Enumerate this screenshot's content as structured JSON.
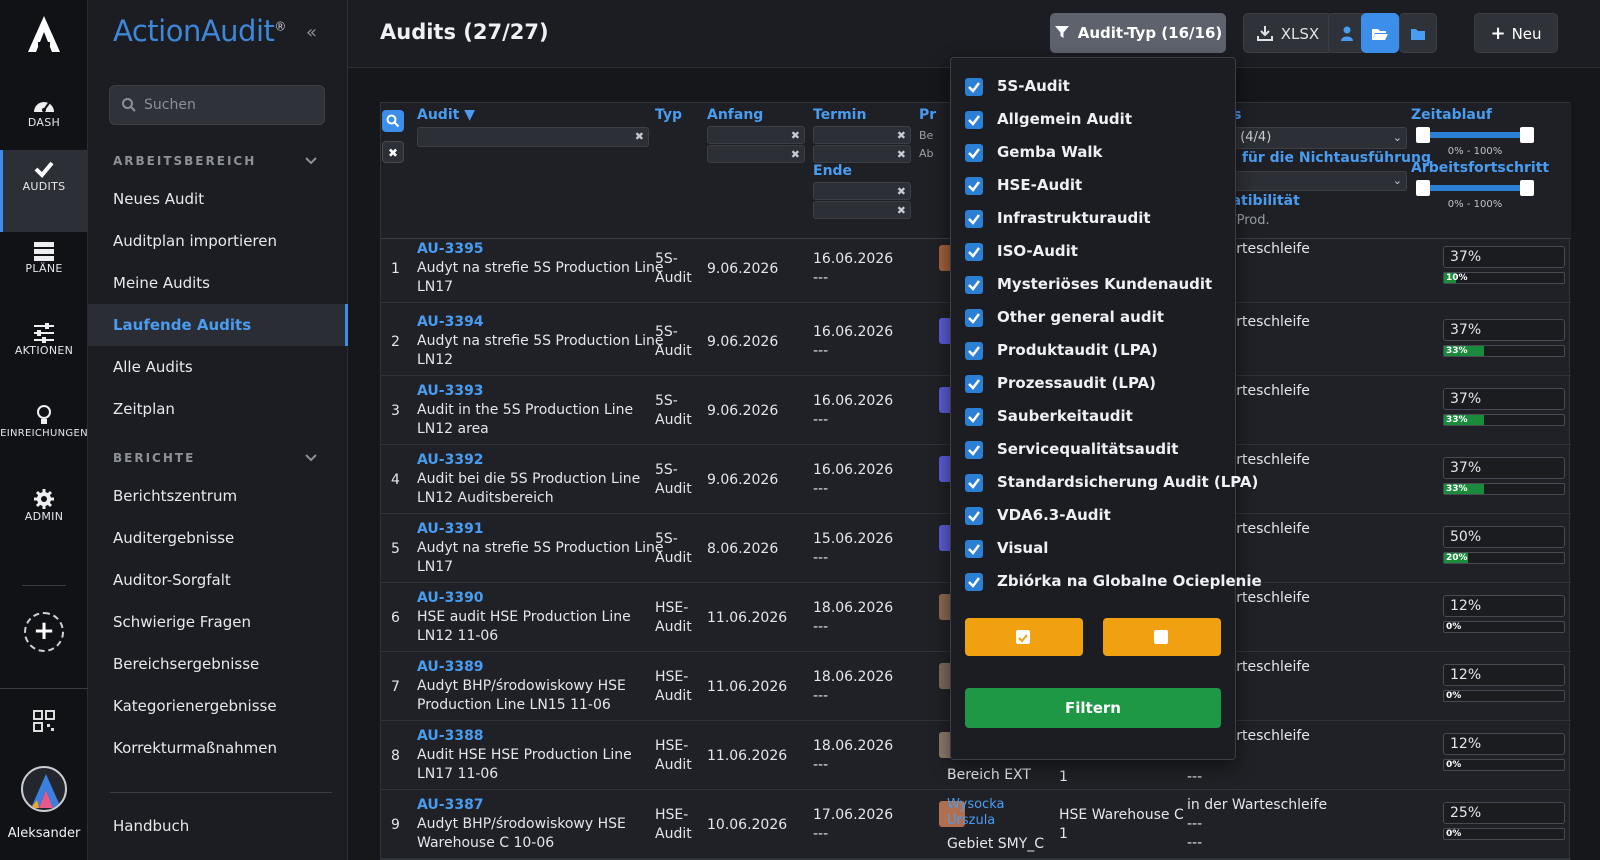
{
  "rail": {
    "items": [
      {
        "label": "DASH"
      },
      {
        "label": "AUDITS"
      },
      {
        "label": "PLÄNE"
      },
      {
        "label": "AKTIONEN"
      },
      {
        "label": "EINREICHUNGEN"
      },
      {
        "label": "ADMIN"
      }
    ],
    "user": "Aleksander"
  },
  "sidebar": {
    "brand": "ActionAudit",
    "brand_mark": "®",
    "search_placeholder": "Suchen",
    "section1": "ARBEITSBEREICH",
    "items1": [
      "Neues Audit",
      "Auditplan importieren",
      "Meine Audits",
      "Laufende Audits",
      "Alle Audits",
      "Zeitplan"
    ],
    "section2": "BERICHTE",
    "items2": [
      "Berichtszentrum",
      "Auditergebnisse",
      "Auditor-Sorgfalt",
      "Schwierige Fragen",
      "Bereichsergebnisse",
      "Kategorienergebnisse",
      "Korrekturmaßnahmen"
    ],
    "handbook": "Handbuch"
  },
  "header": {
    "title": "Audits (27/27)",
    "type_filter": "Audit-Typ (16/16)",
    "xlsx": "XLSX",
    "new": "Neu"
  },
  "table": {
    "headers": {
      "audit": "Audit ▼",
      "typ": "Typ",
      "anfang": "Anfang",
      "termin": "Termin",
      "ende": "Ende",
      "pr": "Pr",
      "pr_sub1": "Be",
      "pr_sub2": "Ab",
      "status": "atus",
      "status_select": "atus (4/4)",
      "grund": "und für die Nichtausführung",
      "kompat": "mpatibilität",
      "kompat_sub": "udit/Prod.",
      "zeitablauf": "Zeitablauf",
      "zeit_range": "0% - 100%",
      "arbeit": "Arbeitsfortschritt",
      "arbeit_range": "0% - 100%"
    },
    "rows": [
      {
        "n": "1",
        "id": "AU-3395",
        "name": [
          "Audyt na strefie 5S Production Line",
          "LN17"
        ],
        "typ": [
          "5S-",
          "Audit"
        ],
        "anfang": "9.06.2026",
        "termin": "16.06.2026",
        "ende": "---",
        "status": "der Warteschleife",
        "time": "37%",
        "time_v": 37,
        "work": "10%",
        "work_v": 10
      },
      {
        "n": "2",
        "id": "AU-3394",
        "name": [
          "Audyt na strefie 5S Production Line",
          "LN12"
        ],
        "typ": [
          "5S-",
          "Audit"
        ],
        "anfang": "9.06.2026",
        "termin": "16.06.2026",
        "ende": "---",
        "status": "der Warteschleife",
        "time": "37%",
        "time_v": 37,
        "work": "33%",
        "work_v": 33
      },
      {
        "n": "3",
        "id": "AU-3393",
        "name": [
          "Audit in the 5S Production Line",
          "LN12 area"
        ],
        "typ": [
          "5S-",
          "Audit"
        ],
        "anfang": "9.06.2026",
        "termin": "16.06.2026",
        "ende": "---",
        "status": "der Warteschleife",
        "time": "37%",
        "time_v": 37,
        "work": "33%",
        "work_v": 33
      },
      {
        "n": "4",
        "id": "AU-3392",
        "name": [
          "Audit bei die 5S Production Line",
          "LN12 Auditsbereich"
        ],
        "typ": [
          "5S-",
          "Audit"
        ],
        "anfang": "9.06.2026",
        "termin": "16.06.2026",
        "ende": "---",
        "status": "der Warteschleife",
        "time": "37%",
        "time_v": 37,
        "work": "33%",
        "work_v": 33
      },
      {
        "n": "5",
        "id": "AU-3391",
        "name": [
          "Audyt na strefie 5S Production Line",
          "LN17"
        ],
        "typ": [
          "5S-",
          "Audit"
        ],
        "anfang": "8.06.2026",
        "termin": "15.06.2026",
        "ende": "---",
        "status": "der Warteschleife",
        "time": "50%",
        "time_v": 50,
        "work": "20%",
        "work_v": 20
      },
      {
        "n": "6",
        "id": "AU-3390",
        "name": [
          "HSE audit HSE Production Line",
          "LN12 11-06"
        ],
        "typ": [
          "HSE-",
          "Audit"
        ],
        "anfang": "11.06.2026",
        "termin": "18.06.2026",
        "ende": "---",
        "status": "der Warteschleife",
        "time": "12%",
        "time_v": 12,
        "work": "0%",
        "work_v": 0
      },
      {
        "n": "7",
        "id": "AU-3389",
        "name": [
          "Audyt BHP/środowiskowy HSE",
          "Production Line LN15 11-06"
        ],
        "typ": [
          "HSE-",
          "Audit"
        ],
        "anfang": "11.06.2026",
        "termin": "18.06.2026",
        "ende": "---",
        "status": "der Warteschleife",
        "time": "12%",
        "time_v": 12,
        "work": "0%",
        "work_v": 0
      },
      {
        "n": "8",
        "id": "AU-3388",
        "name": [
          "Audit HSE HSE Production Line",
          "LN17 11-06"
        ],
        "typ": [
          "HSE-",
          "Audit"
        ],
        "anfang": "11.06.2026",
        "termin": "18.06.2026",
        "ende": "---",
        "status": "der Warteschleife",
        "time": "12%",
        "time_v": 12,
        "work": "0%",
        "work_v": 0,
        "area": "Bereich EXT",
        "count": "1",
        "dash": "---"
      },
      {
        "n": "9",
        "id": "AU-3387",
        "name": [
          "Audyt BHP/środowiskowy HSE",
          "Warehouse C 10-06"
        ],
        "typ": [
          "HSE-",
          "Audit"
        ],
        "anfang": "10.06.2026",
        "termin": "17.06.2026",
        "ende": "---",
        "status": "in der Warteschleife",
        "time": "25%",
        "time_v": 25,
        "work": "0%",
        "work_v": 0,
        "auditor": [
          "Wysocka",
          "Urszula"
        ],
        "area": "Gebiet SMY_C",
        "place": "HSE Warehouse C",
        "count": "1",
        "dash": "---",
        "dash2": "---"
      }
    ]
  },
  "dropdown": {
    "options": [
      "5S-Audit",
      "Allgemein Audit",
      "Gemba Walk",
      "HSE-Audit",
      "Infrastrukturaudit",
      "ISO-Audit",
      "Mysteriöses Kundenaudit",
      "Other general audit",
      "Produktaudit (LPA)",
      "Prozessaudit (LPA)",
      "Sauberkeitaudit",
      "Servicequalitätsaudit",
      "Standardsicherung Audit (LPA)",
      "VDA6.3-Audit",
      "Visual",
      "Zbiórka na Globalne Ocieplenie"
    ],
    "filter_label": "Filtern"
  },
  "colors": {
    "accent": "#3d8eea",
    "success": "#1e9845",
    "warning": "#f1a010"
  }
}
